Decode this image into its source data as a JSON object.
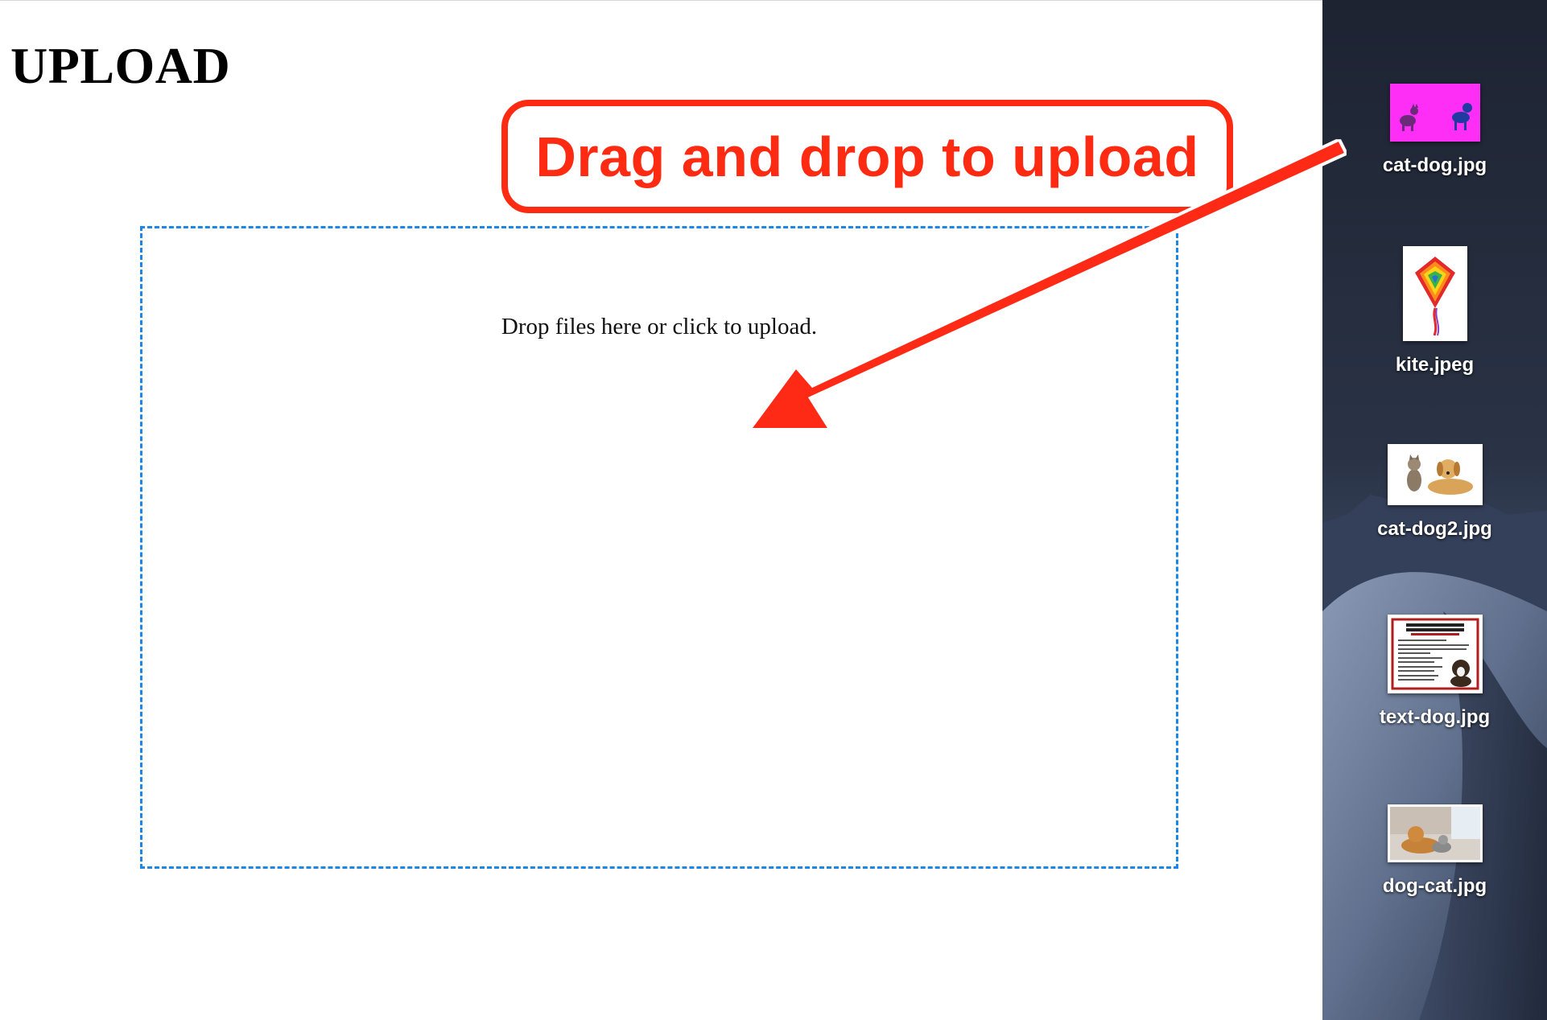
{
  "page": {
    "title": "UPLOAD"
  },
  "dropzone": {
    "text": "Drop files here or click to upload."
  },
  "annotation": {
    "callout_text": "Drag and drop to upload",
    "color": "#ff2a12"
  },
  "desktop": {
    "files": [
      {
        "name": "cat-dog.jpg",
        "icon": "cat-dog-thumbnail-icon"
      },
      {
        "name": "kite.jpeg",
        "icon": "kite-thumbnail-icon"
      },
      {
        "name": "cat-dog2.jpg",
        "icon": "cat-dog2-thumbnail-icon"
      },
      {
        "name": "text-dog.jpg",
        "icon": "text-dog-thumbnail-icon"
      },
      {
        "name": "dog-cat.jpg",
        "icon": "dog-cat-thumbnail-icon"
      }
    ]
  },
  "colors": {
    "dropzone_border": "#1e86e5",
    "callout": "#ff2a12"
  }
}
